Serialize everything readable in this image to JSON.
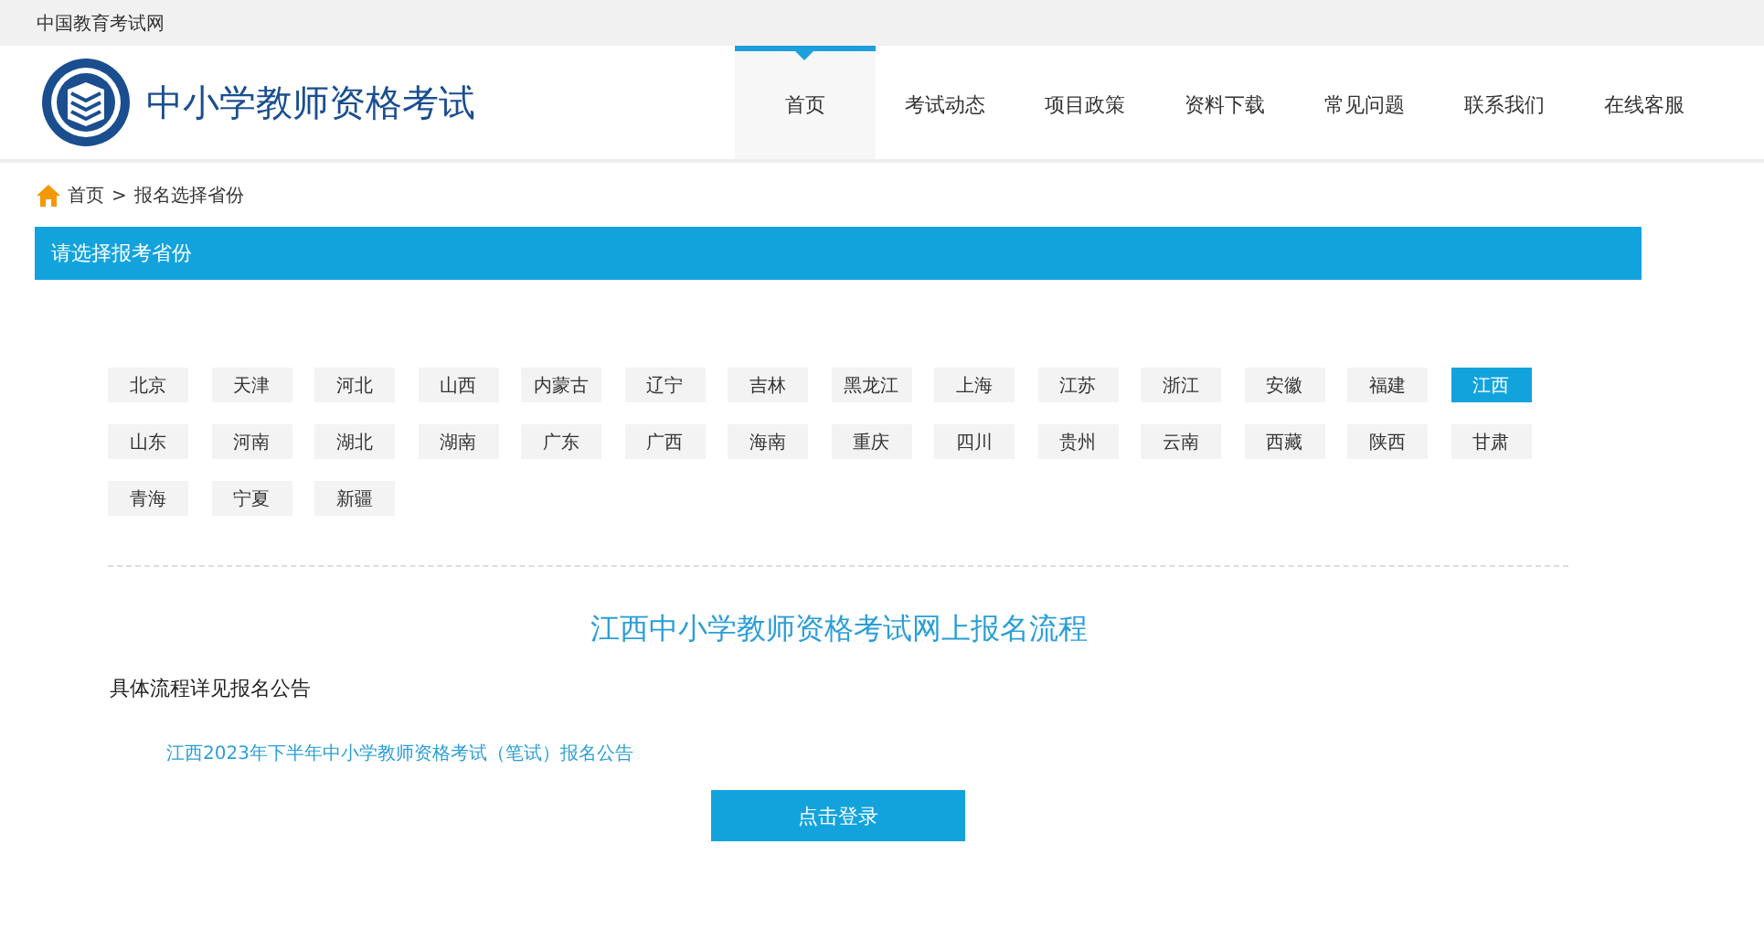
{
  "top_bar": {
    "site_link": "中国教育考试网"
  },
  "header": {
    "title": "中小学教师资格考试"
  },
  "nav": [
    {
      "label": "首页",
      "selected": true
    },
    {
      "label": "考试动态",
      "selected": false
    },
    {
      "label": "项目政策",
      "selected": false
    },
    {
      "label": "资料下载",
      "selected": false
    },
    {
      "label": "常见问题",
      "selected": false
    },
    {
      "label": "联系我们",
      "selected": false
    },
    {
      "label": "在线客服",
      "selected": false
    }
  ],
  "breadcrumb": {
    "home": "首页",
    "separator": ">",
    "current": "报名选择省份"
  },
  "section_title": "请选择报考省份",
  "provinces": [
    {
      "label": "北京",
      "selected": false
    },
    {
      "label": "天津",
      "selected": false
    },
    {
      "label": "河北",
      "selected": false
    },
    {
      "label": "山西",
      "selected": false
    },
    {
      "label": "内蒙古",
      "selected": false
    },
    {
      "label": "辽宁",
      "selected": false
    },
    {
      "label": "吉林",
      "selected": false
    },
    {
      "label": "黑龙江",
      "selected": false
    },
    {
      "label": "上海",
      "selected": false
    },
    {
      "label": "江苏",
      "selected": false
    },
    {
      "label": "浙江",
      "selected": false
    },
    {
      "label": "安徽",
      "selected": false
    },
    {
      "label": "福建",
      "selected": false
    },
    {
      "label": "江西",
      "selected": true
    },
    {
      "label": "山东",
      "selected": false
    },
    {
      "label": "河南",
      "selected": false
    },
    {
      "label": "湖北",
      "selected": false
    },
    {
      "label": "湖南",
      "selected": false
    },
    {
      "label": "广东",
      "selected": false
    },
    {
      "label": "广西",
      "selected": false
    },
    {
      "label": "海南",
      "selected": false
    },
    {
      "label": "重庆",
      "selected": false
    },
    {
      "label": "四川",
      "selected": false
    },
    {
      "label": "贵州",
      "selected": false
    },
    {
      "label": "云南",
      "selected": false
    },
    {
      "label": "西藏",
      "selected": false
    },
    {
      "label": "陕西",
      "selected": false
    },
    {
      "label": "甘肃",
      "selected": false
    },
    {
      "label": "青海",
      "selected": false
    },
    {
      "label": "宁夏",
      "selected": false
    },
    {
      "label": "新疆",
      "selected": false
    }
  ],
  "process": {
    "title": "江西中小学教师资格考试网上报名流程",
    "note": "具体流程详见报名公告",
    "announcement_link": "江西2023年下半年中小学教师资格考试（笔试）报名公告",
    "login_button": "点击登录"
  }
}
